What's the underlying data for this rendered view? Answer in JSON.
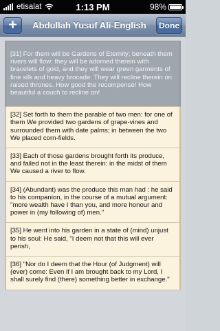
{
  "status_bar": {
    "carrier": "etisalat",
    "time": "1:13 PM",
    "battery": "98%",
    "battery_level": 0.98
  },
  "nav": {
    "add_label": "+",
    "title": "Abdullah Yusuf Ali-English",
    "done_label": "Done"
  },
  "verses": [
    {
      "text": "[31] For them will be Gardens of Eternity; beneath them rivers will flow; they will be adorned therein with bracelets of gold, and they will wear green garments of fine silk and heavy brocade: They will recline therein on raised thrones. How good the recompense! How beautiful a couch to recline on!",
      "selected": true
    },
    {
      "text": "[32] Set forth to them the parable of two men: for one of them We provided two gardens of grape-vines and surrounded them with date palms; in between the two We placed corn-fields.",
      "selected": false
    },
    {
      "text": "[33] Each of those gardens brought forth its produce, and failed not in the least therein: in the midst of them We caused a river to flow.",
      "selected": false
    },
    {
      "text": "[34] (Abundant) was the produce this man had : he said to his companion, in the course of a mutual argument: \"more wealth have I than you, and more honour and power in (my following of) men.\"",
      "selected": false
    },
    {
      "text": "[35] He went into his garden in a state of (mind) unjust to his soul: He said, \"I deem not that this will ever perish,",
      "selected": false
    },
    {
      "text": "[36] \"Nor do I deem that the Hour (of Judgment) will (ever) come: Even if I am brought back to my Lord, I shall surely find (there) something better in exchange.\"",
      "selected": false
    }
  ]
}
